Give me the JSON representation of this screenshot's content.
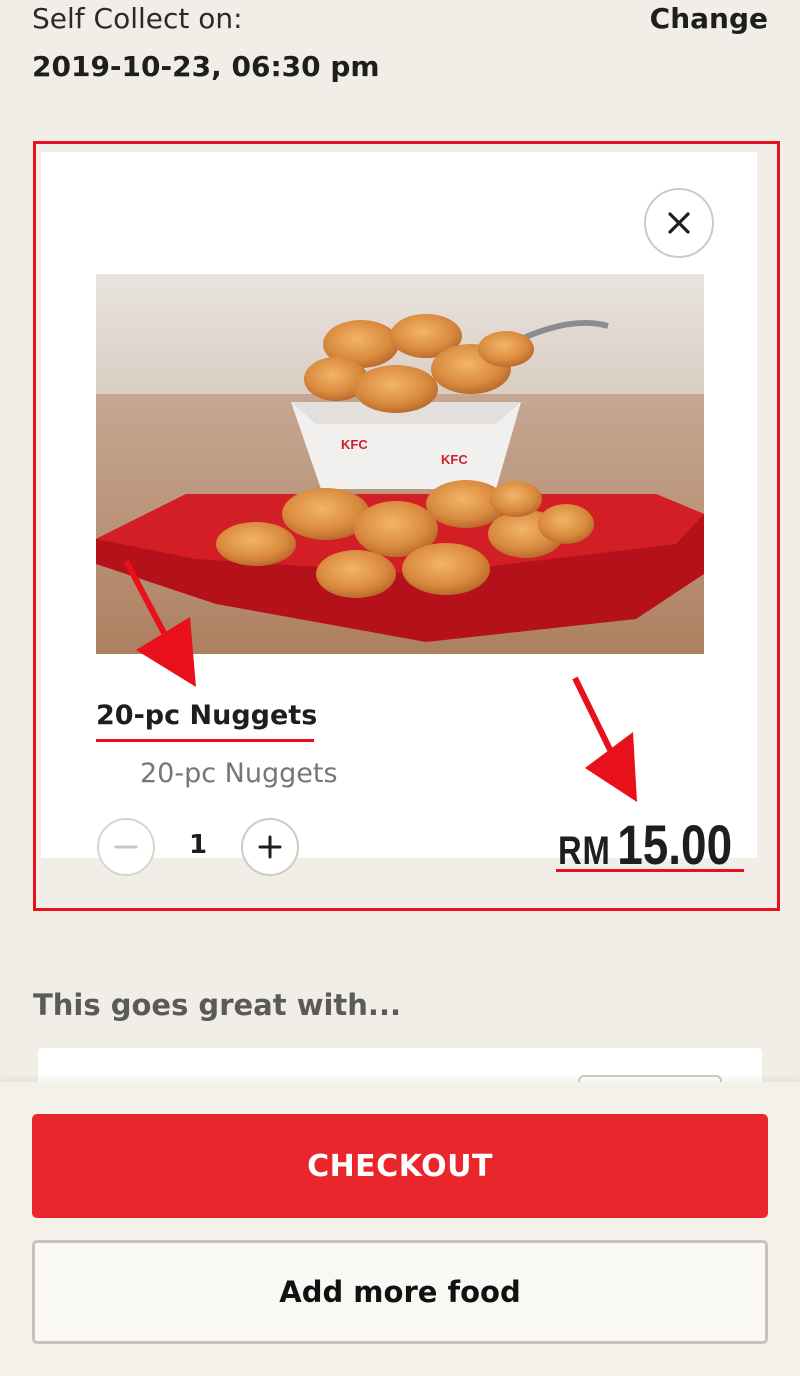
{
  "collection": {
    "label": "Self Collect on:",
    "datetime": "2019-10-23, 06:30 pm",
    "change_label": "Change"
  },
  "cart_item": {
    "name": "20-pc Nuggets",
    "description": "20-pc Nuggets",
    "quantity": "1",
    "price_currency": "RM",
    "price_amount": "15.00",
    "close_icon": "close-icon",
    "minus_icon": "minus-icon",
    "plus_icon": "plus-icon"
  },
  "upsell": {
    "title": "This goes great with..."
  },
  "footer": {
    "checkout_label": "CHECKOUT",
    "add_more_label": "Add more food"
  },
  "colors": {
    "accent_red": "#e8262c",
    "highlight_red": "#e8101a",
    "background": "#f1ede7"
  }
}
